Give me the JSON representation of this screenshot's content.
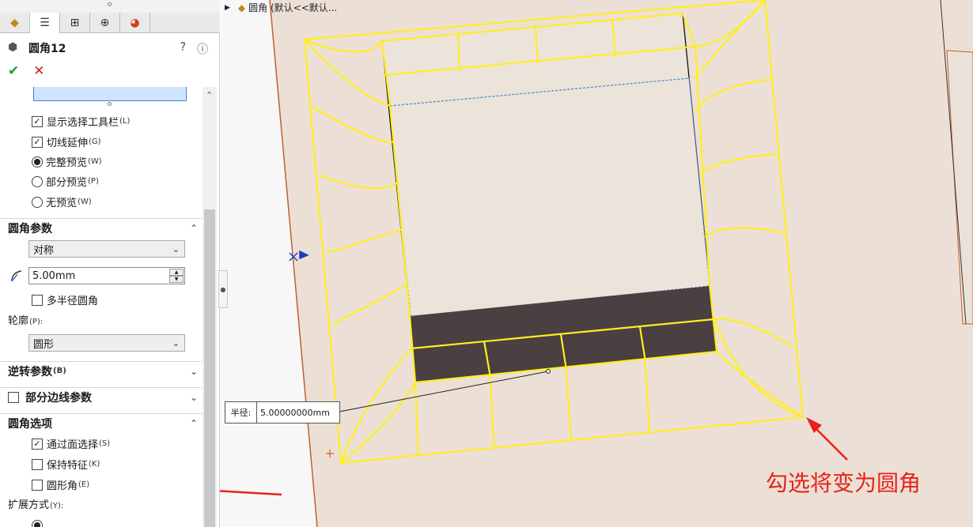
{
  "tree_crumb": {
    "text": "圆角 (默认<<默认..."
  },
  "feature": {
    "title": "圆角12"
  },
  "tabs": [
    {
      "icon": "feature-manager-icon"
    },
    {
      "icon": "property-manager-icon"
    },
    {
      "icon": "configuration-manager-icon"
    },
    {
      "icon": "dimxpert-icon"
    },
    {
      "icon": "display-manager-icon"
    }
  ],
  "options": {
    "show_toolbar": {
      "label": "显示选择工具栏",
      "key": "(L)",
      "checked": true
    },
    "tangent_propagation": {
      "label": "切线延伸",
      "key": "(G)",
      "checked": true
    },
    "full_preview": {
      "label": "完整预览",
      "key": "(W)",
      "selected": true
    },
    "partial_preview": {
      "label": "部分预览",
      "key": "(P)",
      "selected": false
    },
    "no_preview": {
      "label": "无预览",
      "key": "(W)",
      "selected": false
    }
  },
  "fillet_params": {
    "header": "圆角参数",
    "symmetric": "对称",
    "radius_value": "5.00mm",
    "multi_radius": {
      "label": "多半径圆角",
      "checked": false
    },
    "profile_label": "轮廓",
    "profile_key": "(P):",
    "profile_value": "圆形"
  },
  "setback_params": {
    "header": "逆转参数",
    "key": "(B)"
  },
  "partial_edge_params": {
    "header": "部分边线参数"
  },
  "fillet_options": {
    "header": "圆角选项",
    "select_through_faces": {
      "label": "通过面选择",
      "key": "(S)",
      "checked": true
    },
    "keep_features": {
      "label": "保持特征",
      "key": "(K)",
      "checked": false
    },
    "round_corners": {
      "label": "圆形角",
      "key": "(E)",
      "checked": false
    },
    "overflow_type_label": "扩展方式",
    "overflow_type_key": "(Y):"
  },
  "callout": {
    "label": "半径:",
    "value": "5.00000000mm"
  },
  "annotation": {
    "text": "勾选将变为圆角",
    "color": "#e8231b"
  },
  "colors": {
    "preview_yellow": "#ffee22",
    "arrow_red": "#e8231b",
    "face_beige": "#ece0d6",
    "side_dark": "#4a3f41"
  }
}
